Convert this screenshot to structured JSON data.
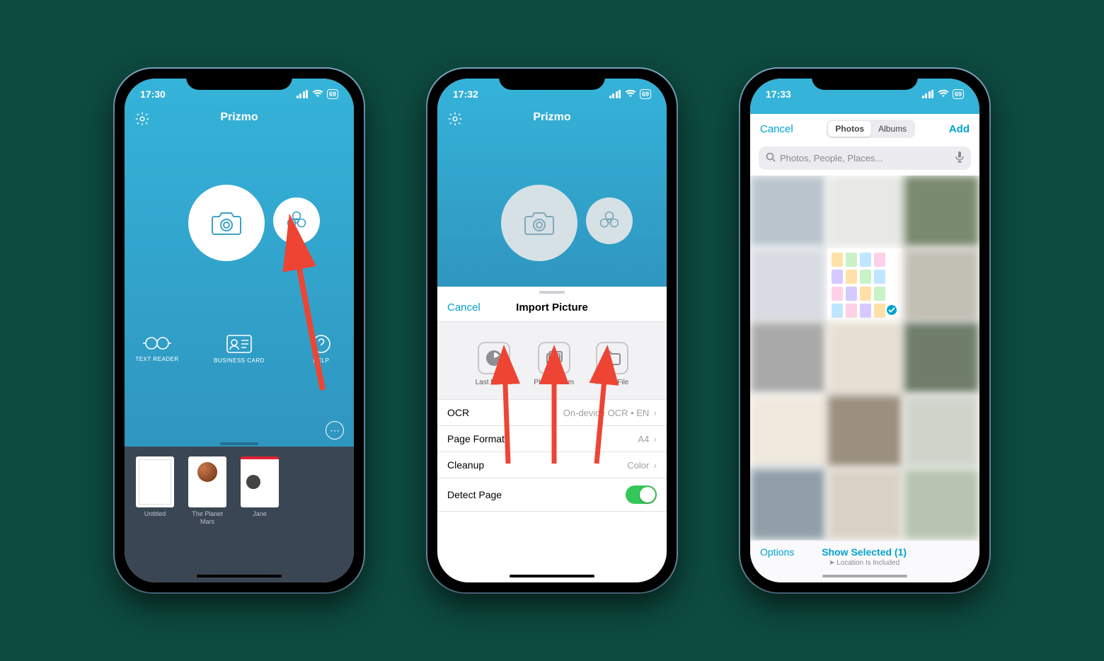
{
  "screen1": {
    "time": "17:30",
    "battery": "69",
    "app_title": "Prizmo",
    "actions": {
      "text_reader": "TEXT READER",
      "business_card": "BUSINESS CARD",
      "help": "HELP"
    },
    "docs": [
      {
        "label": "Untitled"
      },
      {
        "label": "The Planet Mars"
      },
      {
        "label": "Jane"
      }
    ]
  },
  "screen2": {
    "time": "17:32",
    "battery": "69",
    "app_title": "Prizmo",
    "sheet": {
      "cancel": "Cancel",
      "title": "Import Picture",
      "options": {
        "last": "Last Picture",
        "album": "Photo Album",
        "file": "Import File"
      },
      "settings": {
        "ocr": {
          "label": "OCR",
          "value": "On-device OCR • EN"
        },
        "page_format": {
          "label": "Page Format",
          "value": "A4"
        },
        "cleanup": {
          "label": "Cleanup",
          "value": "Color"
        },
        "detect": {
          "label": "Detect Page",
          "on": true
        }
      }
    }
  },
  "screen3": {
    "time": "17:33",
    "battery": "69",
    "cancel": "Cancel",
    "add": "Add",
    "tabs": {
      "photos": "Photos",
      "albums": "Albums"
    },
    "search_placeholder": "Photos, People, Places...",
    "options": "Options",
    "show_selected": "Show Selected (1)",
    "location_note": "Location Is Included"
  }
}
